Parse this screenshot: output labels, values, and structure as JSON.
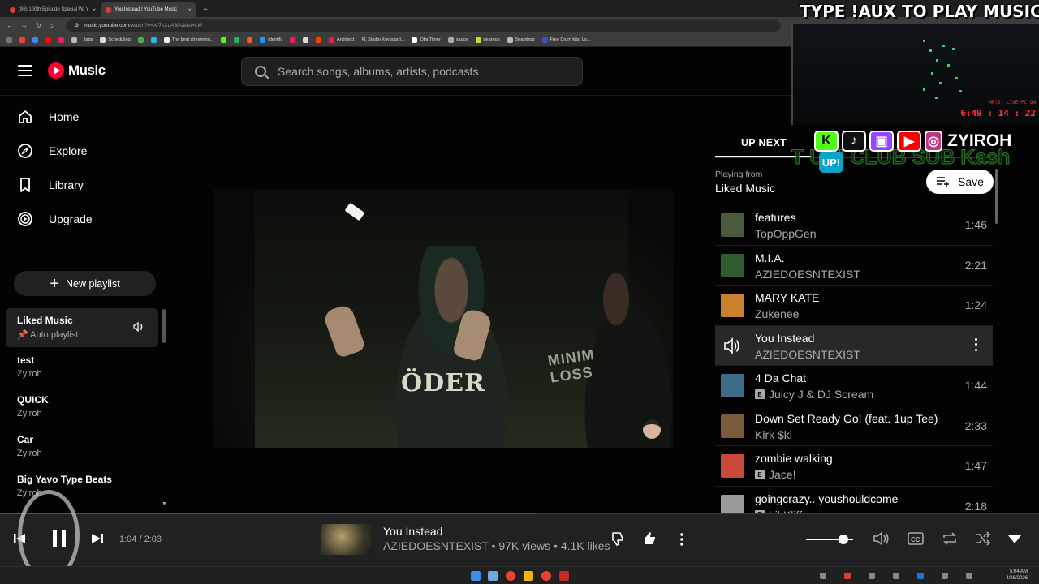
{
  "browser": {
    "tabs": [
      {
        "title": "(86) 100th Episode Special W/ Y",
        "active": false
      },
      {
        "title": "You Instead | YouTube Music",
        "active": true
      }
    ],
    "url": "music.youtube.com",
    "url_rest": "/watch?v=Xr7kXuA8lA&list=LM",
    "bookmarks": [
      "tags",
      "Scheduling",
      "The best streaming...",
      "Identify",
      "Architect",
      "FL Studio Keyboard...",
      "Obs Timer",
      "sauce",
      "pearpop",
      "Snapdrop",
      "Free Drum kits, Lo..."
    ]
  },
  "header": {
    "logo_text": "Music",
    "search_placeholder": "Search songs, albums, artists, podcasts"
  },
  "sidebar": {
    "nav": [
      {
        "label": "Home",
        "icon": "home-icon"
      },
      {
        "label": "Explore",
        "icon": "compass-icon"
      },
      {
        "label": "Library",
        "icon": "bookmark-icon"
      },
      {
        "label": "Upgrade",
        "icon": "upgrade-icon"
      }
    ],
    "new_playlist": "New playlist",
    "playlists": [
      {
        "title": "Liked Music",
        "subtitle": "Auto playlist",
        "active": true
      },
      {
        "title": "test",
        "subtitle": "Zyiroh",
        "active": false
      },
      {
        "title": "QUICK",
        "subtitle": "Zyiroh",
        "active": false
      },
      {
        "title": "Car",
        "subtitle": "Zyiroh",
        "active": false
      },
      {
        "title": "Big Yavo Type Beats",
        "subtitle": "Zyiroh",
        "active": false
      }
    ]
  },
  "upnext": {
    "tab_label": "UP NEXT",
    "playing_from_label": "Playing from",
    "playing_from_name": "Liked Music",
    "save_label": "Save",
    "queue": [
      {
        "title": "features",
        "artist": "TopOppGen",
        "duration": "1:46",
        "explicit": false,
        "thumb": "#4b5a3a"
      },
      {
        "title": "M.I.A.",
        "artist": "AZIEDOESNTEXIST",
        "duration": "2:21",
        "explicit": false,
        "thumb": "#2f5b2f"
      },
      {
        "title": "MARY KATE",
        "artist": "Zukenee",
        "duration": "1:24",
        "explicit": false,
        "thumb": "#c9822c"
      },
      {
        "title": "You Instead",
        "artist": "AZIEDOESNTEXIST",
        "duration": "",
        "explicit": false,
        "thumb": "#282828",
        "active": true
      },
      {
        "title": "4 Da Chat",
        "artist": "Juicy J & DJ Scream",
        "duration": "1:44",
        "explicit": true,
        "thumb": "#3f6b8a"
      },
      {
        "title": "Down Set Ready Go! (feat. 1up Tee)",
        "artist": "Kirk $ki",
        "duration": "2:33",
        "explicit": false,
        "thumb": "#7a5a3a"
      },
      {
        "title": "zombie walking",
        "artist": "Jace!",
        "duration": "1:47",
        "explicit": true,
        "thumb": "#c94a3a"
      },
      {
        "title": "goingcrazy.. youshouldcome",
        "artist": "Lil Kliff",
        "duration": "2:18",
        "explicit": true,
        "thumb": "#999999"
      }
    ]
  },
  "overlay": {
    "title": "TYPE !AUX TO PLAY MUSIC!",
    "cam_line1": "HR(2) LIVE+PC ON",
    "cam_line2": "6:49 : 14 : 22",
    "social_name": "ZYIROH",
    "social_icons": [
      "kick-icon",
      "tiktok-icon",
      "twitch-icon",
      "youtube-icon",
      "instagram-icon"
    ],
    "marquee": "T  UP!  CLUB SUB Kash",
    "up_badge": "UP!"
  },
  "player": {
    "time": "1:04 / 2:03",
    "progress": 0.516,
    "volume": 0.7,
    "title": "You Instead",
    "meta": "AZIEDOESNTEXIST • 97K views • 4.1K likes"
  },
  "taskbar": {
    "time": "5:04 AM",
    "date": "4/28/2026"
  },
  "colors": {
    "accent": "#ff0033",
    "background": "#030303",
    "player_bg": "#212121"
  }
}
